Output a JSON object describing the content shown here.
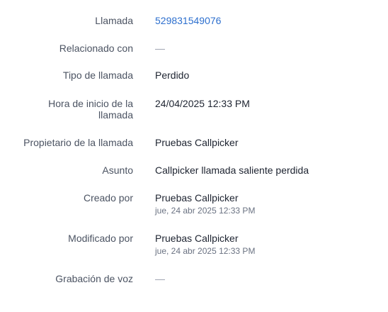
{
  "fields": [
    {
      "label": "Llamada",
      "value": "529831549076"
    },
    {
      "label": "Relacionado con",
      "value": "—"
    },
    {
      "label": "Tipo de llamada",
      "value": "Perdido"
    },
    {
      "label": "Hora de inicio de la llamada",
      "value": "24/04/2025 12:33 PM"
    },
    {
      "label": "Propietario de la llamada",
      "value": "Pruebas Callpicker"
    },
    {
      "label": "Asunto",
      "value": "Callpicker llamada saliente perdida"
    },
    {
      "label": "Creado por",
      "value": "Pruebas Callpicker",
      "sub": "jue, 24 abr 2025 12:33 PM"
    },
    {
      "label": "Modificado por",
      "value": "Pruebas Callpicker",
      "sub": "jue, 24 abr 2025 12:33 PM"
    },
    {
      "label": "Grabación de voz",
      "value": "—"
    }
  ],
  "colors": {
    "label": "#4b5362",
    "value": "#1d2330",
    "link": "#2d6fce",
    "muted": "#6a7282"
  }
}
